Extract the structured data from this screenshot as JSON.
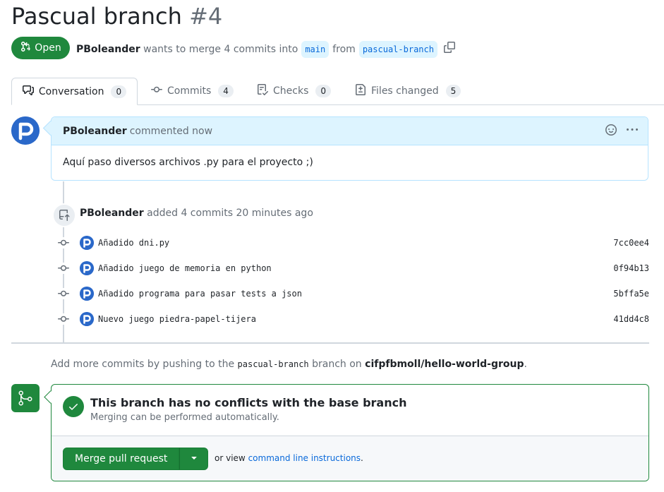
{
  "pr": {
    "title": "Pascual branch",
    "number": "#4",
    "state_label": "Open",
    "author": "PBoleander",
    "meta_middle": "wants to merge 4 commits into",
    "base_branch": "main",
    "from_word": "from",
    "head_branch": "pascual-branch"
  },
  "tabs": [
    {
      "label": "Conversation",
      "count": "0"
    },
    {
      "label": "Commits",
      "count": "4"
    },
    {
      "label": "Checks",
      "count": "0"
    },
    {
      "label": "Files changed",
      "count": "5"
    }
  ],
  "comment": {
    "author": "PBoleander",
    "action": "commented now",
    "body": "Aquí paso diversos archivos .py para el proyecto ;)"
  },
  "event": {
    "author": "PBoleander",
    "text": "added 4 commits 20 minutes ago"
  },
  "commits": [
    {
      "message": "Añadido dni.py",
      "sha": "7cc0ee4"
    },
    {
      "message": "Añadido juego de memoria en python",
      "sha": "0f94b13"
    },
    {
      "message": "Añadido programa para pasar tests a json",
      "sha": "5bffa5e"
    },
    {
      "message": "Nuevo juego piedra-papel-tijera",
      "sha": "41dd4c8"
    }
  ],
  "hint": {
    "prefix": "Add more commits by pushing to the",
    "branch": "pascual-branch",
    "middle": "branch on",
    "repo": "cifpfbmoll/hello-world-group",
    "suffix": "."
  },
  "merge": {
    "title": "This branch has no conflicts with the base branch",
    "subtitle": "Merging can be performed automatically.",
    "button_label": "Merge pull request",
    "cli_prefix": "or view",
    "cli_link": "command line instructions",
    "cli_suffix": "."
  },
  "colors": {
    "open_green": "#1f883d",
    "link_blue": "#0969da",
    "avatar_blue": "#2a68c9"
  }
}
